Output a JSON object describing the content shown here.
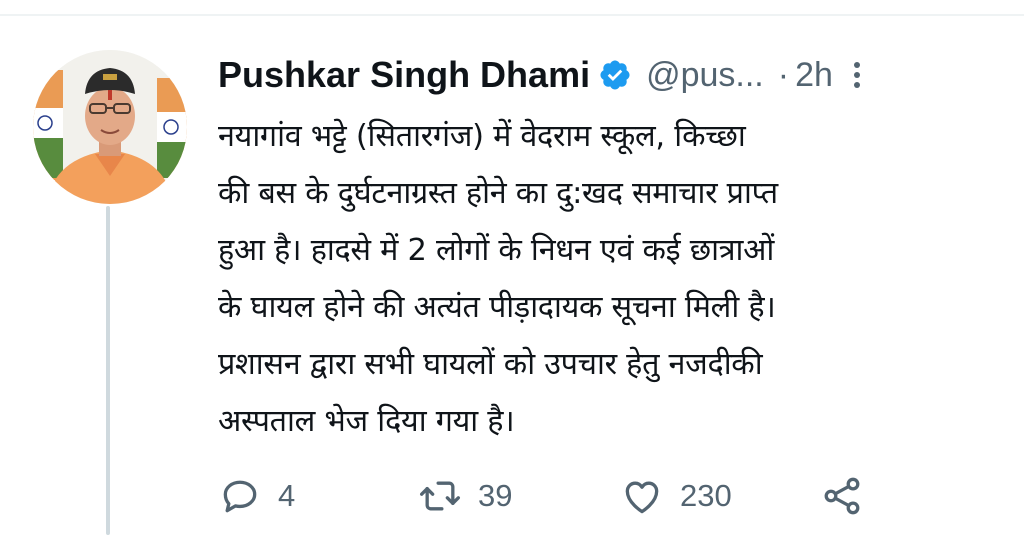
{
  "tweet": {
    "author_name": "Pushkar Singh Dhami",
    "handle": "@pus...",
    "separator": "·",
    "time": "2h",
    "text_lines": [
      "नयागांव भट्टे (सितारगंज) में वेदराम स्कूल, किच्छा",
      "की बस के दुर्घटनाग्रस्त होने का दु:खद समाचार प्राप्त",
      "हुआ है। हादसे में 2 लोगों के निधन एवं कई छात्राओं",
      "के घायल होने की अत्यंत पीड़ादायक सूचना मिली है।",
      "प्रशासन द्वारा सभी घायलों को उपचार हेतु नजदीकी",
      "अस्पताल भेज दिया गया है।"
    ],
    "counts": {
      "replies": "4",
      "retweets": "39",
      "likes": "230"
    }
  },
  "colors": {
    "text": "#0f1419",
    "secondary": "#536471",
    "verified": "#1d9bf0",
    "divider": "#eff3f4"
  },
  "icons": {
    "verified": "verified-badge-icon",
    "more": "more-options-icon",
    "reply": "reply-icon",
    "retweet": "retweet-icon",
    "like": "like-icon",
    "share": "share-icon"
  }
}
